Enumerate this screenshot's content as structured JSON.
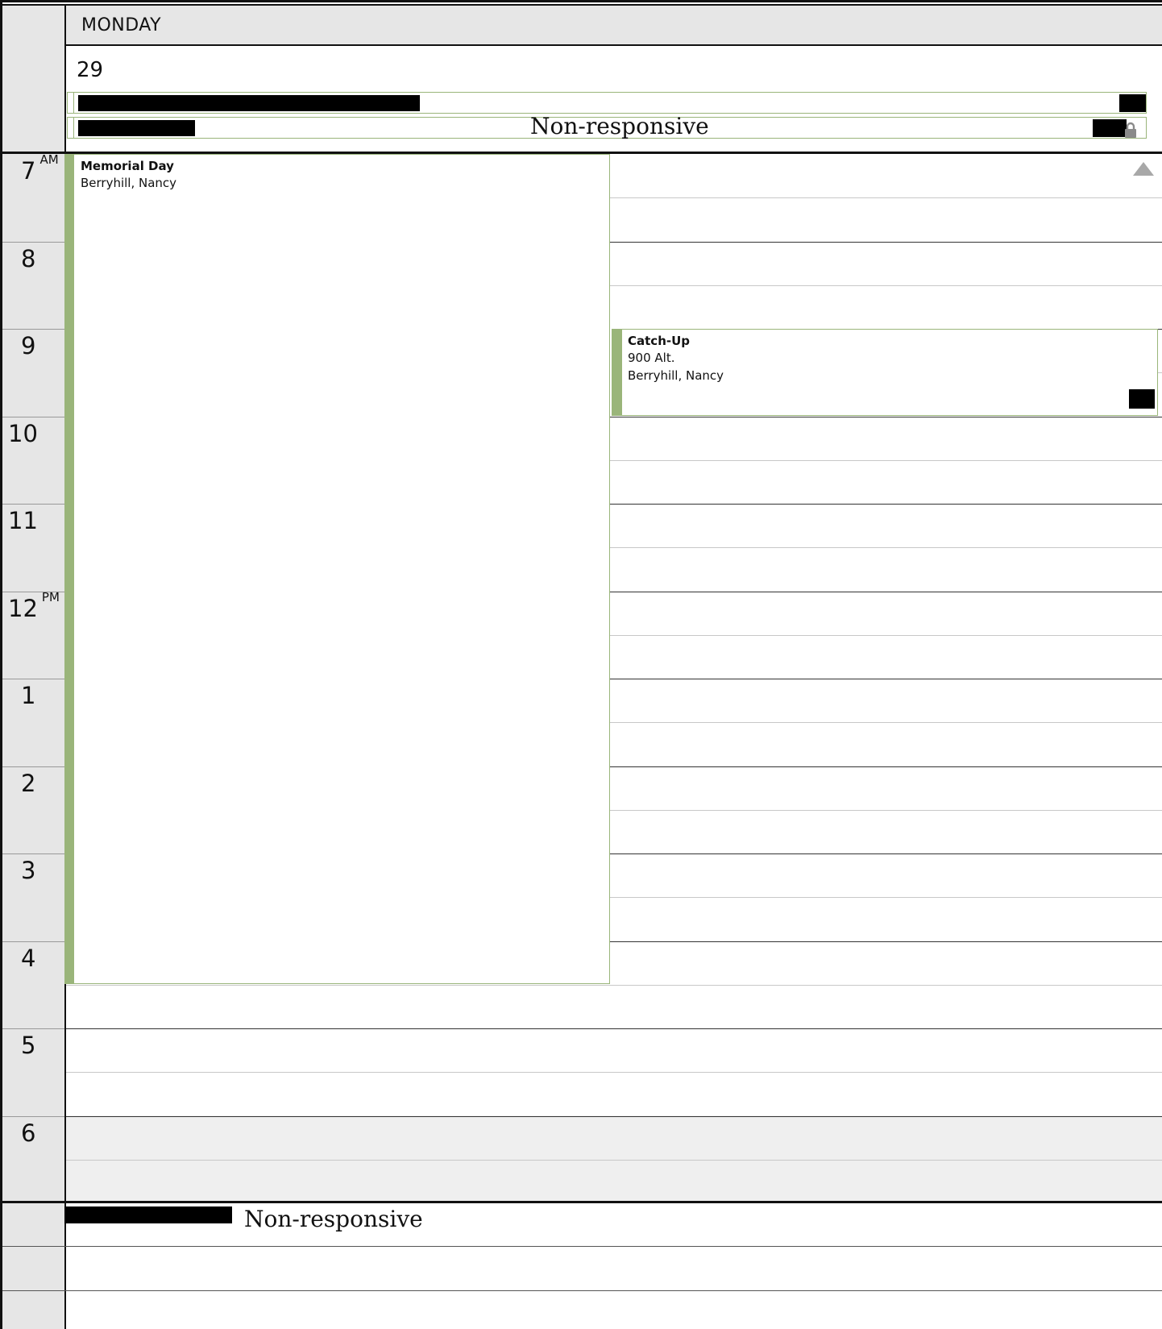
{
  "header": {
    "day_name": "MONDAY",
    "date": "29"
  },
  "all_day": {
    "row2_text": "Non-responsive"
  },
  "hours": [
    {
      "label": "7",
      "suffix": "AM"
    },
    {
      "label": "8",
      "suffix": ""
    },
    {
      "label": "9",
      "suffix": ""
    },
    {
      "label": "10",
      "suffix": ""
    },
    {
      "label": "11",
      "suffix": ""
    },
    {
      "label": "12",
      "suffix": "PM"
    },
    {
      "label": "1",
      "suffix": ""
    },
    {
      "label": "2",
      "suffix": ""
    },
    {
      "label": "3",
      "suffix": ""
    },
    {
      "label": "4",
      "suffix": ""
    },
    {
      "label": "5",
      "suffix": ""
    },
    {
      "label": "6",
      "suffix": ""
    }
  ],
  "events": {
    "memorial": {
      "title": "Memorial Day",
      "organizer": "Berryhill, Nancy"
    },
    "catchup": {
      "title": "Catch-Up",
      "location": "900 Alt.",
      "organizer": "Berryhill, Nancy"
    }
  },
  "footer": {
    "text": "Non-responsive"
  },
  "colors": {
    "event_accent": "#9ab57a",
    "gutter": "#e6e6e6"
  },
  "icons": {
    "scroll_up": "triangle-up-icon",
    "lock": "lock-icon"
  }
}
